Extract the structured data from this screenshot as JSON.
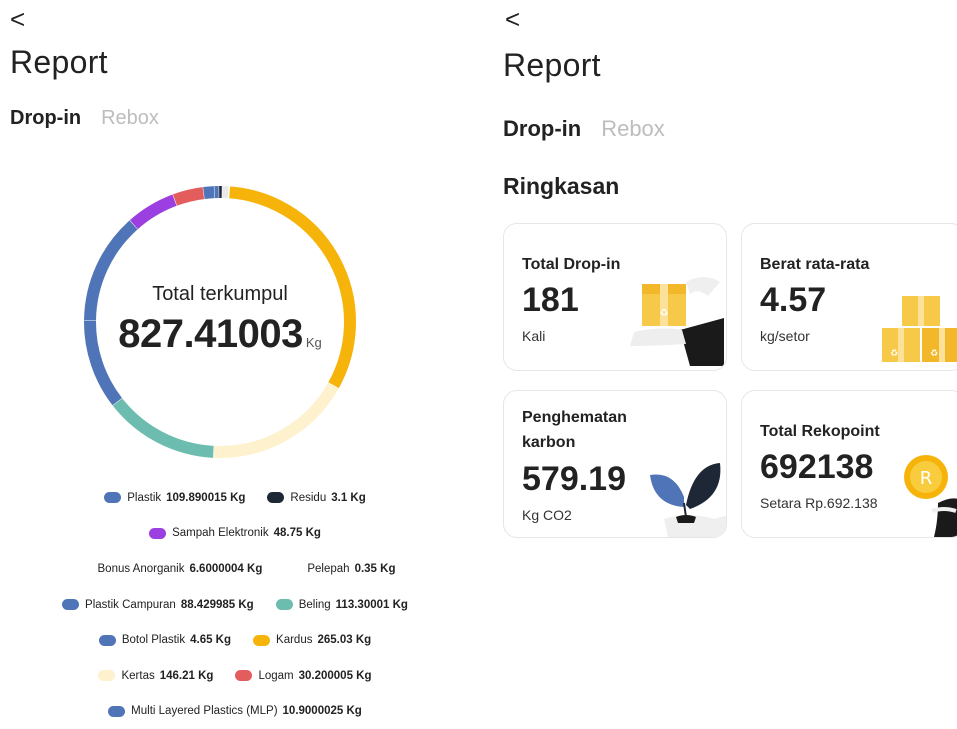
{
  "left": {
    "back_label": "<",
    "title": "Report",
    "tabs": [
      {
        "label": "Drop-in",
        "active": true
      },
      {
        "label": "Rebox",
        "active": false
      }
    ],
    "chart_data": {
      "type": "pie",
      "variant": "donut",
      "center_title": "Total terkumpul",
      "total": "827.41003",
      "unit": "Kg",
      "slices": [
        {
          "name": "Plastik",
          "value_label": "109.890015 Kg",
          "value": 109.890015,
          "color": "#4f74b8"
        },
        {
          "name": "Residu",
          "value_label": "3.1 Kg",
          "value": 3.1,
          "color": "#1e2736"
        },
        {
          "name": "Sampah Elektronik",
          "value_label": "48.75 Kg",
          "value": 48.75,
          "color": "#9b3fe0"
        },
        {
          "name": "Bonus Anorganik",
          "value_label": "6.6000004 Kg",
          "value": 6.6000004,
          "color": "#ffffff"
        },
        {
          "name": "Pelepah",
          "value_label": "0.35 Kg",
          "value": 0.35,
          "color": "#ffffff"
        },
        {
          "name": "Plastik Campuran",
          "value_label": "88.429985 Kg",
          "value": 88.429985,
          "color": "#4f74b8"
        },
        {
          "name": "Beling",
          "value_label": "113.30001 Kg",
          "value": 113.30001,
          "color": "#6cbdb0"
        },
        {
          "name": "Botol Plastik",
          "value_label": "4.65 Kg",
          "value": 4.65,
          "color": "#4f74b8"
        },
        {
          "name": "Kardus",
          "value_label": "265.03 Kg",
          "value": 265.03,
          "color": "#f6b40b"
        },
        {
          "name": "Kertas",
          "value_label": "146.21 Kg",
          "value": 146.21,
          "color": "#fdf1ce"
        },
        {
          "name": "Logam",
          "value_label": "30.200005 Kg",
          "value": 30.200005,
          "color": "#e35d5d"
        },
        {
          "name": "Multi Layered Plastics (MLP)",
          "value_label": "10.9000025 Kg",
          "value": 10.9000025,
          "color": "#4f74b8"
        }
      ]
    },
    "legend_rows": [
      [
        {
          "name": "Plastik",
          "value_label": "109.890015 Kg",
          "color": "#4f74b8"
        },
        {
          "name": "Residu",
          "value_label": "3.1 Kg",
          "color": "#1e2736"
        }
      ],
      [
        {
          "name": "Sampah Elektronik",
          "value_label": "48.75 Kg",
          "color": "#9b3fe0"
        }
      ],
      [
        {
          "name": "Bonus Anorganik",
          "value_label": "6.6000004 Kg",
          "color": "#ffffff"
        },
        {
          "name": "Pelepah",
          "value_label": "0.35 Kg",
          "color": "#ffffff"
        }
      ],
      [
        {
          "name": "Plastik Campuran",
          "value_label": "88.429985 Kg",
          "color": "#4f74b8"
        },
        {
          "name": "Beling",
          "value_label": "113.30001 Kg",
          "color": "#6cbdb0"
        }
      ],
      [
        {
          "name": "Botol Plastik",
          "value_label": "4.65 Kg",
          "color": "#4f74b8"
        },
        {
          "name": "Kardus",
          "value_label": "265.03 Kg",
          "color": "#f6b40b"
        }
      ],
      [
        {
          "name": "Kertas",
          "value_label": "146.21 Kg",
          "color": "#fdf1ce"
        },
        {
          "name": "Logam",
          "value_label": "30.200005 Kg",
          "color": "#e35d5d"
        }
      ],
      [
        {
          "name": "Multi Layered Plastics (MLP)",
          "value_label": "10.9000025 Kg",
          "color": "#4f74b8"
        }
      ]
    ]
  },
  "right": {
    "back_label": "<",
    "title": "Report",
    "tabs": [
      {
        "label": "Drop-in",
        "active": true
      },
      {
        "label": "Rebox",
        "active": false
      }
    ],
    "section_title": "Ringkasan",
    "cards": [
      {
        "title_lines": [
          "Total Drop-in"
        ],
        "value": "181",
        "unit": "Kali",
        "icon": "hand-box-icon"
      },
      {
        "title_lines": [
          "Berat rata-rata"
        ],
        "value": "4.57",
        "unit": "kg/setor",
        "icon": "boxes-icon"
      },
      {
        "title_lines": [
          "Penghematan",
          "karbon"
        ],
        "value": "579.19",
        "unit": "Kg CO2",
        "icon": "plant-hand-icon"
      },
      {
        "title_lines": [
          "Total Rekopoint"
        ],
        "value": "692138",
        "unit": "Setara Rp.692.138",
        "icon": "coin-hand-icon"
      }
    ],
    "colors": {
      "accent": "#f6b40b",
      "box": "#f7c948",
      "leaf": "#4f74b8",
      "leaf_dark": "#1e2736"
    }
  }
}
